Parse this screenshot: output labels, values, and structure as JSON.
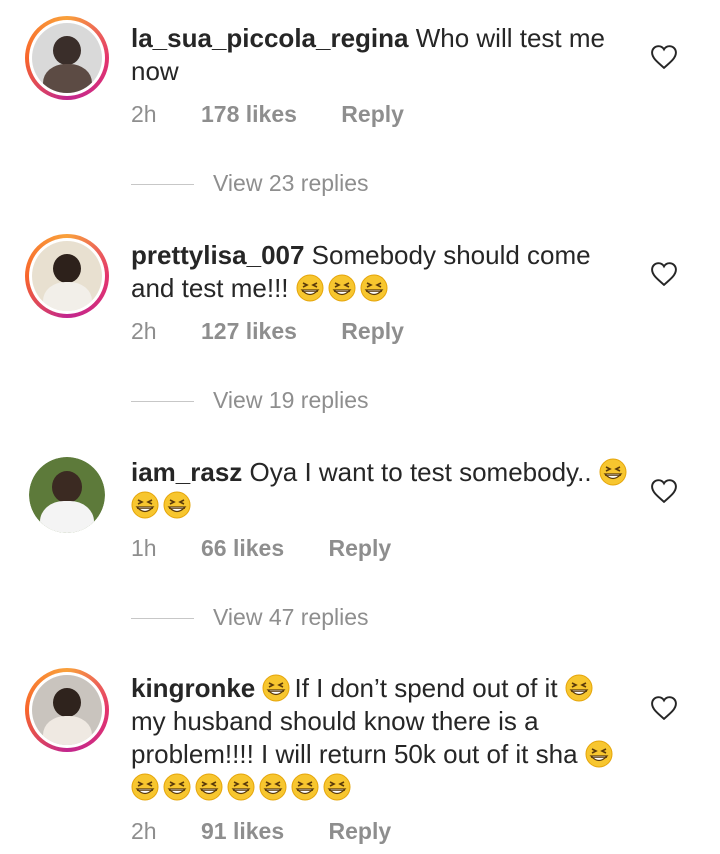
{
  "comments": [
    {
      "username": "la_sua_piccola_regina",
      "segments": [
        " Who will test me now"
      ],
      "time": "2h",
      "likes": "178 likes",
      "reply": "Reply",
      "view_replies": "View 23 replies"
    },
    {
      "username": "prettylisa_007",
      "segments": [
        " Somebody should come and test me!!! "
      ],
      "time": "2h",
      "likes": "127 likes",
      "reply": "Reply",
      "view_replies": "View 19 replies"
    },
    {
      "username": "iam_rasz",
      "segments": [
        " Oya I want to test somebody.. "
      ],
      "time": "1h",
      "likes": "66 likes",
      "reply": "Reply",
      "view_replies": "View 47 replies"
    },
    {
      "username": "kingronke",
      "segments": [
        " ",
        "If I don’t spend out of it ",
        "my husband should know there is a problem!!!! I will return 50k out of it sha "
      ],
      "time": "2h",
      "likes": "91 likes",
      "reply": "Reply"
    }
  ],
  "icons": {
    "like": "heart-outline-icon",
    "emoji": "grinning-squinting-face-emoji"
  },
  "colors": {
    "text": "#262626",
    "meta": "#8e8e8e",
    "emoji": "#f7c62f"
  }
}
